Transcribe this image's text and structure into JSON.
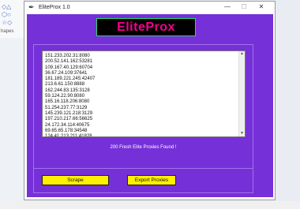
{
  "background": {
    "ribbon_label": "hapes"
  },
  "window": {
    "title": "EliteProx 1.0",
    "controls": {
      "minimize": "—",
      "maximize": "☐",
      "close": "✕"
    }
  },
  "app": {
    "logo": "EliteProx",
    "proxies": [
      "151.233.202.31:8080",
      "200.52.141.162:53281",
      "109.167.40.129:60704",
      "36.67.24.109:37641",
      "181.189.221.245:42407",
      "213.6.61.150:8888",
      "162.244.83.135:3128",
      "59.124.22.90:8080",
      "165.16.118.206:8080",
      "51.254.237.77:3129",
      "145.239.121.218:3129",
      "197.210.217.66:56625",
      "24.172.34.114:40675",
      "69.65.65.178:34548",
      "124.41.213.211:41828"
    ],
    "status": "200 Fresh Elite Proxies Found !",
    "scrape_label": "Scrape",
    "export_label": "Export Proxies"
  },
  "colors": {
    "client_bg": "#7630d8",
    "logo_text": "#f4008c",
    "button_bg": "#ffef00"
  }
}
